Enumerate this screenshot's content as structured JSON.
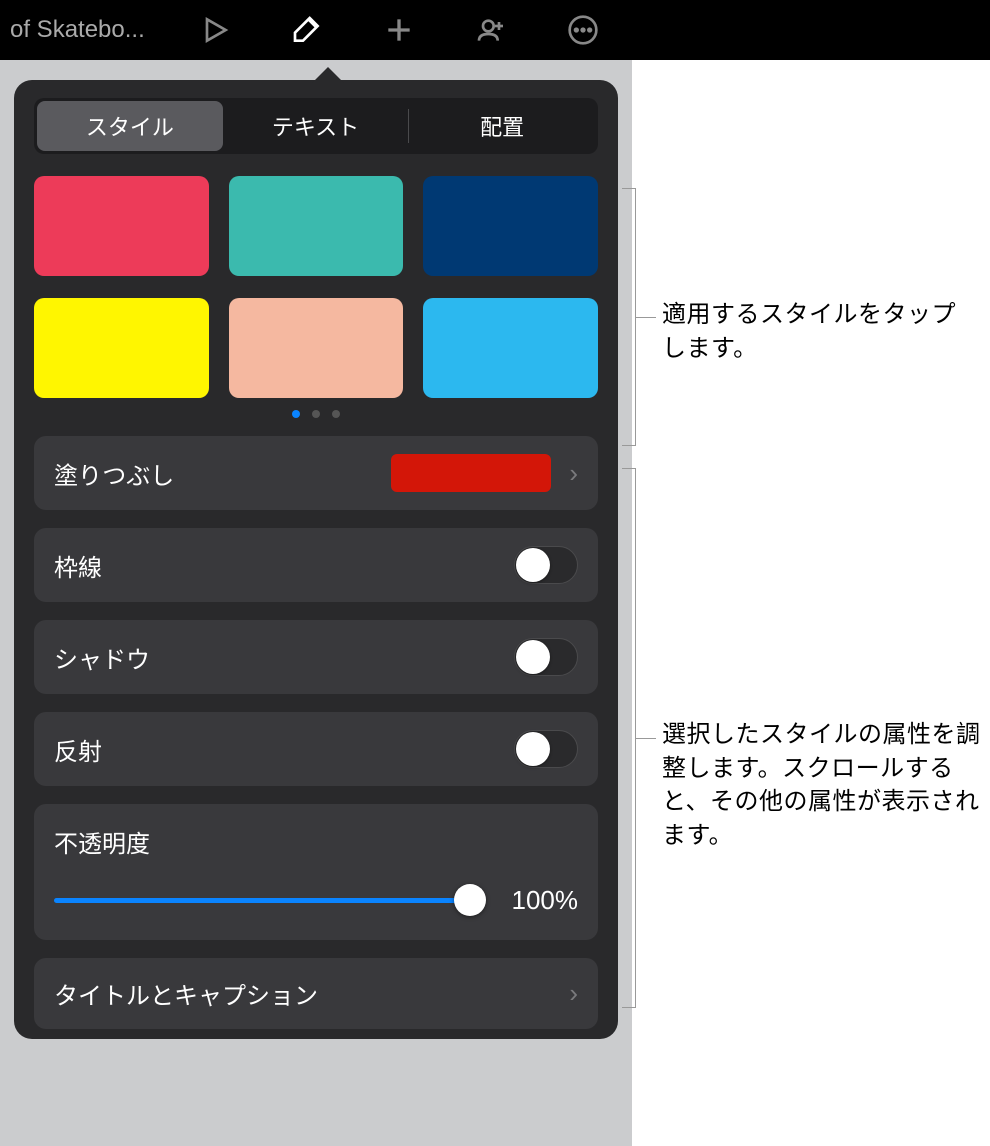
{
  "toolbar": {
    "doc_title": "of Skatebo..."
  },
  "tabs": {
    "style": "スタイル",
    "text": "テキスト",
    "arrange": "配置"
  },
  "swatches": [
    {
      "name": "red-pink",
      "color": "#ed3b59"
    },
    {
      "name": "teal",
      "color": "#3bbaae"
    },
    {
      "name": "navy",
      "color": "#003973"
    },
    {
      "name": "yellow",
      "color": "#fff600"
    },
    {
      "name": "peach",
      "color": "#f5b8a0"
    },
    {
      "name": "sky-blue",
      "color": "#2cb8ef"
    }
  ],
  "rows": {
    "fill": {
      "label": "塗りつぶし",
      "color": "#d31608"
    },
    "border": {
      "label": "枠線",
      "on": false
    },
    "shadow": {
      "label": "シャドウ",
      "on": false
    },
    "reflection": {
      "label": "反射",
      "on": false
    },
    "opacity": {
      "label": "不透明度",
      "value": "100%",
      "percent": 100
    },
    "title_caption": {
      "label": "タイトルとキャプション"
    }
  },
  "callouts": {
    "c1": "適用するスタイルをタップします。",
    "c2": "選択したスタイルの属性を調整します。スクロールすると、その他の属性が表示されます。"
  }
}
